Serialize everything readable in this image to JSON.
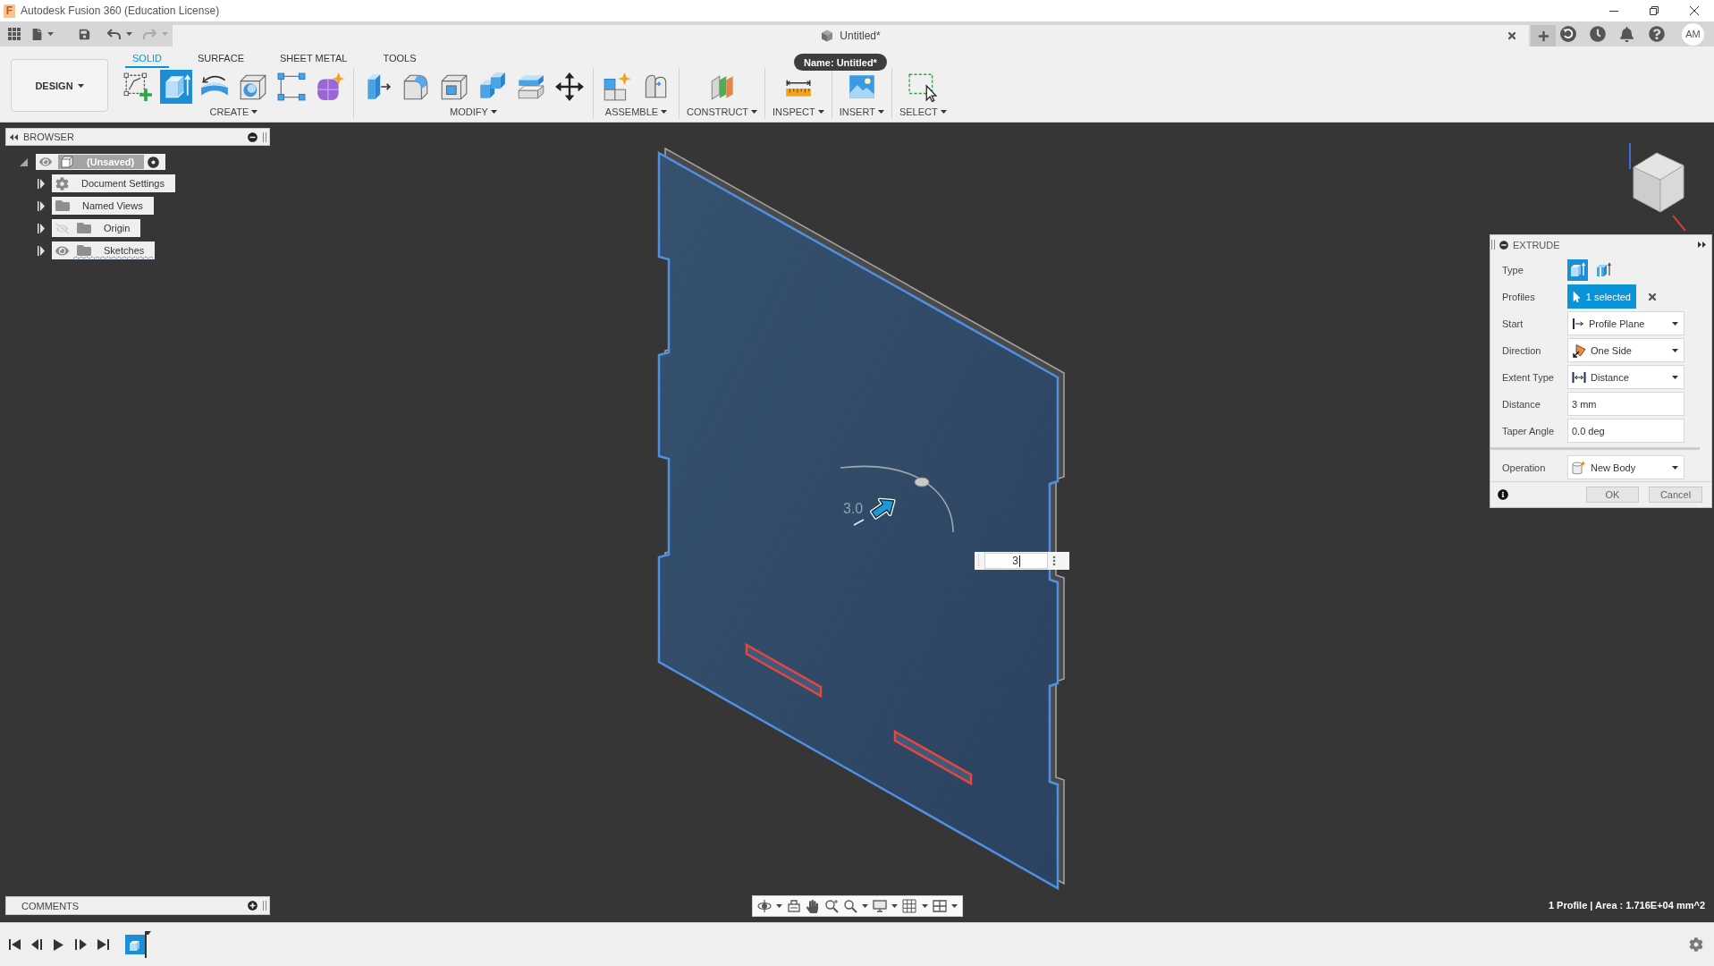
{
  "window": {
    "logo_letter": "F",
    "title": "Autodesk Fusion 360 (Education License)"
  },
  "quick_access": {
    "undo": {
      "disabled": false
    },
    "redo": {
      "disabled": true
    }
  },
  "document_tab": {
    "title": "Untitled*",
    "tooltip": "Name: Untitled*"
  },
  "account": {
    "initials": "AM"
  },
  "workspace": {
    "label": "DESIGN"
  },
  "ribbon_tabs": [
    {
      "label": "SOLID",
      "selected": true
    },
    {
      "label": "SURFACE",
      "selected": false
    },
    {
      "label": "SHEET METAL",
      "selected": false
    },
    {
      "label": "TOOLS",
      "selected": false
    }
  ],
  "tool_groups": [
    {
      "label": "CREATE",
      "tools": [
        {
          "kind": "sketch",
          "selected": false
        },
        {
          "kind": "extrude",
          "selected": true
        },
        {
          "kind": "revolve",
          "selected": false
        },
        {
          "kind": "hole",
          "selected": false
        },
        {
          "kind": "pattern",
          "selected": false
        },
        {
          "kind": "form",
          "selected": false
        }
      ]
    },
    {
      "label": "MODIFY",
      "tools": [
        {
          "kind": "press-pull",
          "selected": false
        },
        {
          "kind": "fillet",
          "selected": false
        },
        {
          "kind": "shell",
          "selected": false
        },
        {
          "kind": "combine",
          "selected": false
        },
        {
          "kind": "split",
          "selected": false
        },
        {
          "kind": "move",
          "selected": false
        }
      ]
    },
    {
      "label": "ASSEMBLE",
      "tools": [
        {
          "kind": "new-component",
          "selected": false
        },
        {
          "kind": "joint",
          "selected": false
        }
      ]
    },
    {
      "label": "CONSTRUCT",
      "tools": [
        {
          "kind": "plane",
          "selected": false
        }
      ]
    },
    {
      "label": "INSPECT",
      "tools": [
        {
          "kind": "measure",
          "selected": false
        }
      ]
    },
    {
      "label": "INSERT",
      "tools": [
        {
          "kind": "image",
          "selected": false
        }
      ]
    },
    {
      "label": "SELECT",
      "tools": [
        {
          "kind": "select",
          "selected": false
        }
      ]
    }
  ],
  "browser": {
    "title": "BROWSER",
    "root": {
      "label": "(Unsaved)",
      "expanded": true
    },
    "items": [
      {
        "label": "Document Settings",
        "kind": "settings",
        "expanded": false,
        "underlined": false
      },
      {
        "label": "Named Views",
        "kind": "folder",
        "expanded": false,
        "underlined": false
      },
      {
        "label": "Origin",
        "kind": "folder",
        "visible": false,
        "expanded": false,
        "underlined": false
      },
      {
        "label": "Sketches",
        "kind": "folder",
        "visible": true,
        "expanded": false,
        "underlined": true
      }
    ]
  },
  "viewport": {
    "dimension_label": "3.0",
    "distance_input": "3"
  },
  "extrude": {
    "title": "EXTRUDE",
    "rows": [
      {
        "label": "Type",
        "kind": "type",
        "options": [
          {
            "kind": "solid",
            "selected": true
          },
          {
            "kind": "thin",
            "selected": false
          }
        ]
      },
      {
        "label": "Profiles",
        "kind": "selection",
        "value": "1 selected"
      },
      {
        "label": "Start",
        "kind": "dropdown",
        "value": "Profile Plane"
      },
      {
        "label": "Direction",
        "kind": "dropdown",
        "value": "One Side"
      },
      {
        "label": "Extent Type",
        "kind": "dropdown",
        "value": "Distance"
      },
      {
        "label": "Distance",
        "kind": "input",
        "value": "3 mm"
      },
      {
        "label": "Taper Angle",
        "kind": "input",
        "value": "0.0 deg"
      }
    ],
    "operation_rows": [
      {
        "label": "Operation",
        "kind": "dropdown",
        "value": "New Body"
      }
    ],
    "buttons": [
      {
        "label": "OK"
      },
      {
        "label": "Cancel"
      }
    ]
  },
  "comments": {
    "title": "COMMENTS"
  },
  "status_bar": {
    "text": "1 Profile | Area : 1.716E+04 mm^2"
  }
}
